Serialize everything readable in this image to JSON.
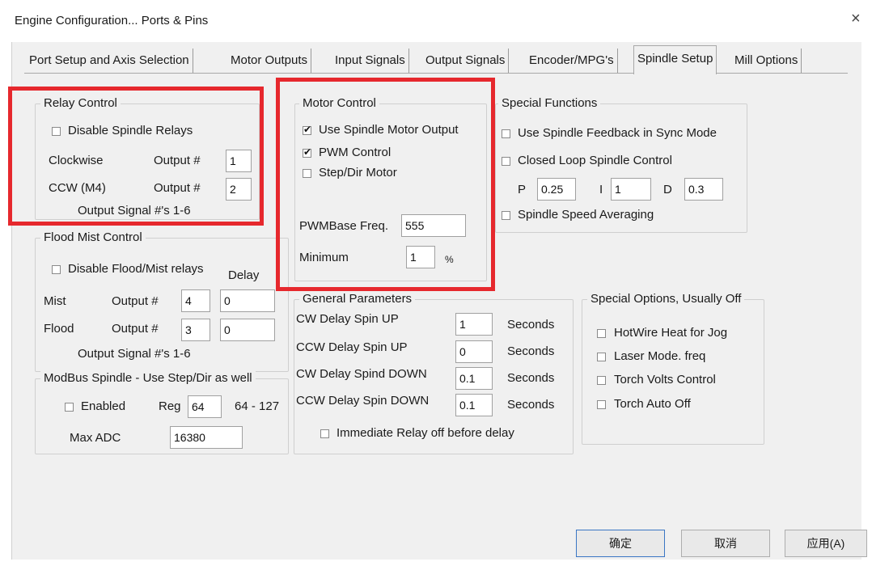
{
  "window": {
    "title": "Engine Configuration... Ports & Pins",
    "close_glyph": "×"
  },
  "tabs": [
    {
      "label": "Port Setup and Axis Selection",
      "active": false
    },
    {
      "label": "Motor Outputs",
      "active": false
    },
    {
      "label": "Input Signals",
      "active": false
    },
    {
      "label": "Output Signals",
      "active": false
    },
    {
      "label": "Encoder/MPG's",
      "active": false
    },
    {
      "label": "Spindle Setup",
      "active": true
    },
    {
      "label": "Mill Options",
      "active": false
    }
  ],
  "relay": {
    "legend": "Relay Control",
    "disable_label": "Disable Spindle Relays",
    "disable_checked": false,
    "cw_label": "Clockwise",
    "ccw_label": "CCW (M4)",
    "output_label": "Output #",
    "cw_output": "1",
    "ccw_output": "2",
    "range_label": "Output Signal #'s 1-6"
  },
  "flood": {
    "legend": "Flood Mist Control",
    "disable_label": "Disable Flood/Mist relays",
    "disable_checked": false,
    "delay_label": "Delay",
    "mist_label": "Mist",
    "flood_label": "Flood",
    "output_label": "Output #",
    "mist_output": "4",
    "mist_delay": "0",
    "flood_output": "3",
    "flood_delay": "0",
    "range_label": "Output Signal #'s 1-6"
  },
  "modbus": {
    "legend": "ModBus Spindle - Use Step/Dir as well",
    "enabled_label": "Enabled",
    "enabled_checked": false,
    "reg_label": "Reg",
    "reg_value": "64",
    "reg_range": "64 - 127",
    "maxadc_label": "Max ADC",
    "maxadc_value": "16380"
  },
  "motor": {
    "legend": "Motor Control",
    "use_output_label": "Use Spindle Motor Output",
    "use_output_checked": true,
    "pwm_label": "PWM Control",
    "pwm_checked": true,
    "stepdir_label": "Step/Dir Motor",
    "stepdir_checked": false,
    "pwmbase_label": "PWMBase Freq.",
    "pwmbase_value": "555",
    "minimum_label": "Minimum",
    "minimum_value": "1",
    "percent": "%"
  },
  "special": {
    "legend": "Special Functions",
    "feedback_label": "Use Spindle Feedback in Sync Mode",
    "feedback_checked": false,
    "closed_loop_label": "Closed Loop Spindle Control",
    "closed_loop_checked": false,
    "p_label": "P",
    "p_value": "0.25",
    "i_label": "I",
    "i_value": "1",
    "d_label": "D",
    "d_value": "0.3",
    "averaging_label": "Spindle Speed Averaging",
    "averaging_checked": false
  },
  "general": {
    "legend": "General Parameters",
    "seconds_label": "Seconds",
    "rows": [
      {
        "label": "CW Delay Spin UP",
        "value": "1"
      },
      {
        "label": "CCW Delay Spin UP",
        "value": "0"
      },
      {
        "label": "CW Delay Spind DOWN",
        "value": "0.1"
      },
      {
        "label": "CCW Delay Spin DOWN",
        "value": "0.1"
      }
    ],
    "immediate_label": "Immediate Relay off before delay",
    "immediate_checked": false
  },
  "options": {
    "legend": "Special Options, Usually Off",
    "items": [
      {
        "label": "HotWire Heat for Jog",
        "checked": false
      },
      {
        "label": "Laser Mode. freq",
        "checked": false
      },
      {
        "label": "Torch Volts Control",
        "checked": false
      },
      {
        "label": "Torch Auto Off",
        "checked": false
      }
    ]
  },
  "buttons": {
    "ok": "确定",
    "cancel": "取消",
    "apply": "应用(A)"
  },
  "colors": {
    "highlight": "#e6282d",
    "panel": "#f0f0f0"
  }
}
